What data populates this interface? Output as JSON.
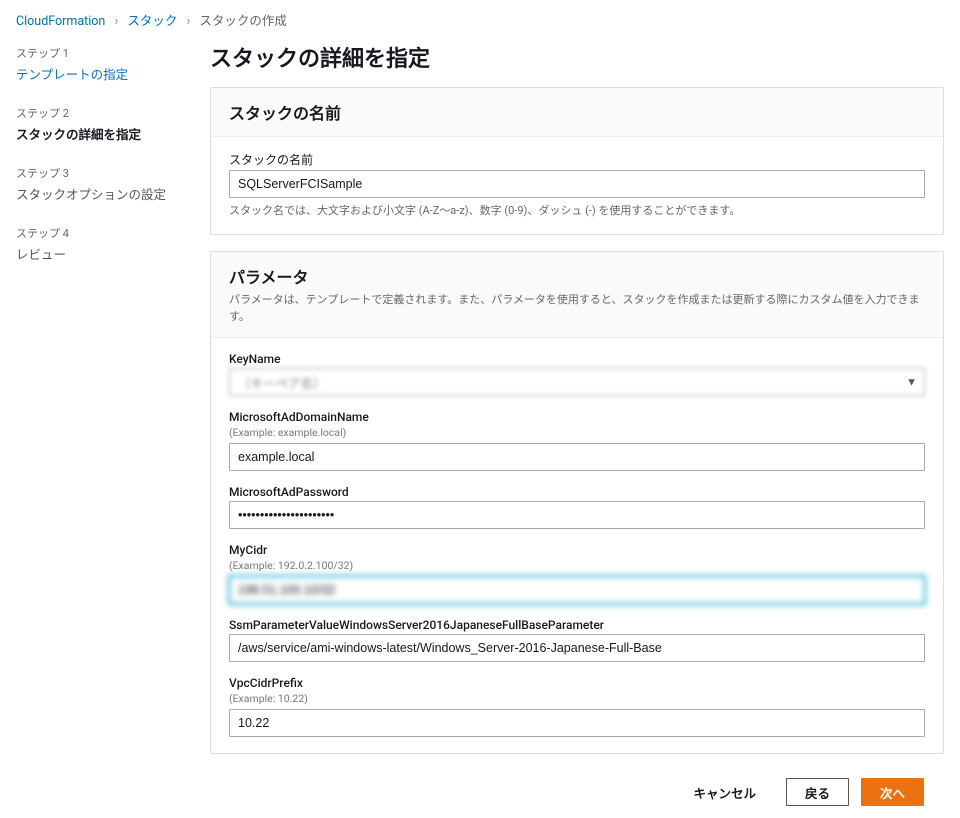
{
  "breadcrumb": {
    "root": "CloudFormation",
    "mid": "スタック",
    "current": "スタックの作成"
  },
  "steps": [
    {
      "label": "ステップ 1",
      "title": "テンプレートの指定",
      "state": "done"
    },
    {
      "label": "ステップ 2",
      "title": "スタックの詳細を指定",
      "state": "current"
    },
    {
      "label": "ステップ 3",
      "title": "スタックオプションの設定",
      "state": "future"
    },
    {
      "label": "ステップ 4",
      "title": "レビュー",
      "state": "future"
    }
  ],
  "page_title": "スタックの詳細を指定",
  "stack_name": {
    "section_title": "スタックの名前",
    "label": "スタックの名前",
    "value": "SQLServerFCISample",
    "help": "スタック名では、大文字および小文字 (A-Z～a-z)、数字 (0-9)、ダッシュ (-) を使用することができます。"
  },
  "parameters": {
    "section_title": "パラメータ",
    "section_desc": "パラメータは、テンプレートで定義されます。また、パラメータを使用すると、スタックを作成または更新する際にカスタム値を入力できます。",
    "key_name": {
      "label": "KeyName",
      "value": "（キーペア名）"
    },
    "ad_domain": {
      "label": "MicrosoftAdDomainName",
      "hint": "(Example: example.local)",
      "value": "example.local"
    },
    "ad_password": {
      "label": "MicrosoftAdPassword",
      "value": "••••••••••••••••••••••"
    },
    "my_cidr": {
      "label": "MyCidr",
      "hint": "(Example: 192.0.2.100/32)",
      "value": "198.51.100.10/32"
    },
    "ssm_param": {
      "label": "SsmParameterValueWindowsServer2016JapaneseFullBaseParameter",
      "value": "/aws/service/ami-windows-latest/Windows_Server-2016-Japanese-Full-Base"
    },
    "vpc_cidr_prefix": {
      "label": "VpcCidrPrefix",
      "hint": "(Example: 10.22)",
      "value": "10.22"
    }
  },
  "footer": {
    "cancel": "キャンセル",
    "back": "戻る",
    "next": "次へ"
  }
}
